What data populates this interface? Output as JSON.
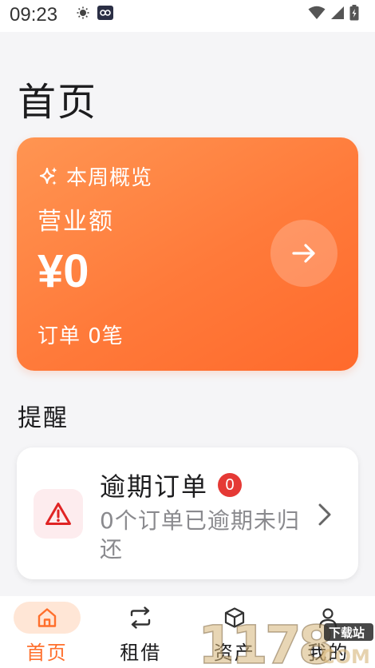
{
  "status_bar": {
    "time": "09:23"
  },
  "page_title": "首页",
  "weekly_overview": {
    "label": "本周概览",
    "revenue_label": "营业额",
    "revenue_value": "¥0",
    "orders_text": "订单 0笔"
  },
  "reminders": {
    "section_title": "提醒",
    "overdue": {
      "title": "逾期订单",
      "badge_count": "0",
      "description": "0个订单已逾期未归还"
    }
  },
  "bottom_nav": {
    "items": [
      {
        "label": "首页",
        "icon": "home-icon",
        "active": true
      },
      {
        "label": "租借",
        "icon": "swap-icon",
        "active": false
      },
      {
        "label": "资产",
        "icon": "box-icon",
        "active": false
      },
      {
        "label": "我的",
        "icon": "user-icon",
        "active": false
      }
    ]
  },
  "watermark": {
    "text": "1178",
    "tag": "下载站",
    "domain": "COM"
  },
  "colors": {
    "accent": "#ff6f2c",
    "card_gradient_start": "#ff9552",
    "card_gradient_end": "#ff6a2c",
    "alert_red": "#e53935"
  }
}
